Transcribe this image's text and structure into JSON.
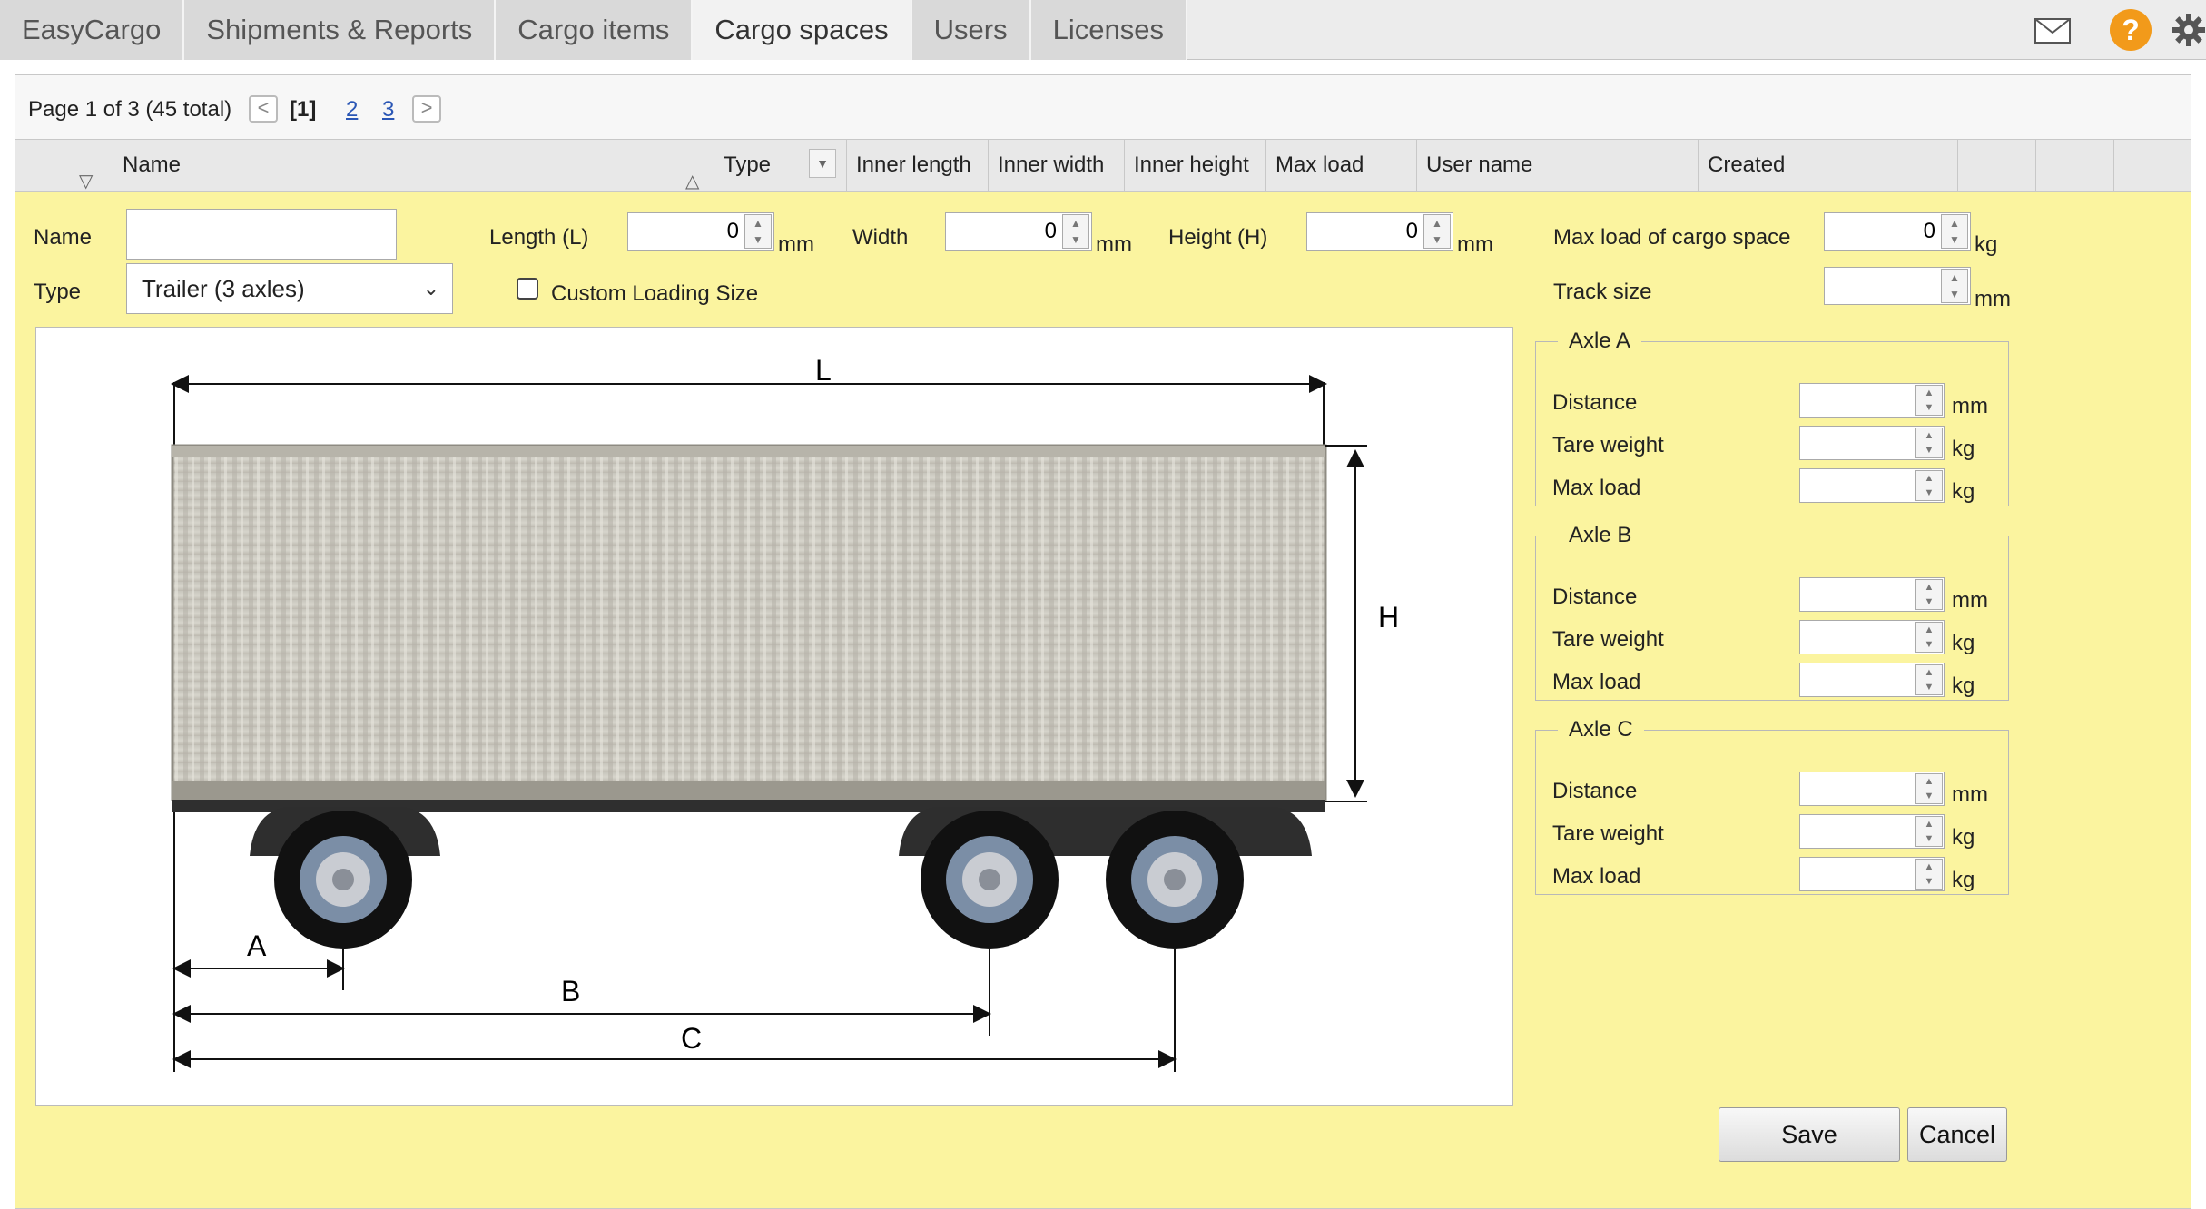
{
  "topbar": {
    "tabs": [
      {
        "label": "EasyCargo"
      },
      {
        "label": "Shipments & Reports"
      },
      {
        "label": "Cargo items"
      },
      {
        "label": "Cargo spaces"
      },
      {
        "label": "Users"
      },
      {
        "label": "Licenses"
      }
    ],
    "active_tab": "Cargo spaces",
    "help_glyph": "?",
    "icons": [
      "mail-icon",
      "help-icon",
      "gear-icon"
    ]
  },
  "pager": {
    "info": "Page 1 of 3 (45 total)",
    "prev_glyph": "<",
    "next_glyph": ">",
    "pages": [
      "[1]",
      "2",
      "3"
    ]
  },
  "table": {
    "columns": [
      "Name",
      "Type",
      "Inner length",
      "Inner width",
      "Inner height",
      "Max load",
      "User name",
      "Created"
    ]
  },
  "form": {
    "name_label": "Name",
    "name_value": "",
    "type_label": "Type",
    "type_value": "Trailer (3 axles)",
    "length_label": "Length (L)",
    "length_value": "0",
    "length_unit": "mm",
    "width_label": "Width",
    "width_value": "0",
    "width_unit": "mm",
    "height_label": "Height (H)",
    "height_value": "0",
    "height_unit": "mm",
    "maxload_label": "Max load of cargo space",
    "maxload_value": "0",
    "maxload_unit": "kg",
    "custom_loading_label": "Custom Loading Size",
    "custom_loading_checked": false,
    "track_label": "Track size",
    "track_value": "",
    "track_unit": "mm",
    "diagram_labels": {
      "L": "L",
      "H": "H",
      "A": "A",
      "B": "B",
      "C": "C"
    },
    "axles": [
      {
        "title": "Axle A",
        "rows": [
          {
            "label": "Distance",
            "unit": "mm"
          },
          {
            "label": "Tare weight",
            "unit": "kg"
          },
          {
            "label": "Max load",
            "unit": "kg"
          }
        ]
      },
      {
        "title": "Axle B",
        "rows": [
          {
            "label": "Distance",
            "unit": "mm"
          },
          {
            "label": "Tare weight",
            "unit": "kg"
          },
          {
            "label": "Max load",
            "unit": "kg"
          }
        ]
      },
      {
        "title": "Axle C",
        "rows": [
          {
            "label": "Distance",
            "unit": "mm"
          },
          {
            "label": "Tare weight",
            "unit": "kg"
          },
          {
            "label": "Max load",
            "unit": "kg"
          }
        ]
      }
    ],
    "save_label": "Save",
    "cancel_label": "Cancel"
  },
  "colors": {
    "form_bg": "#fbf49f",
    "tab_bg": "#d9d9d9",
    "help_icon": "#f29a1a",
    "link": "#2a56b5"
  }
}
